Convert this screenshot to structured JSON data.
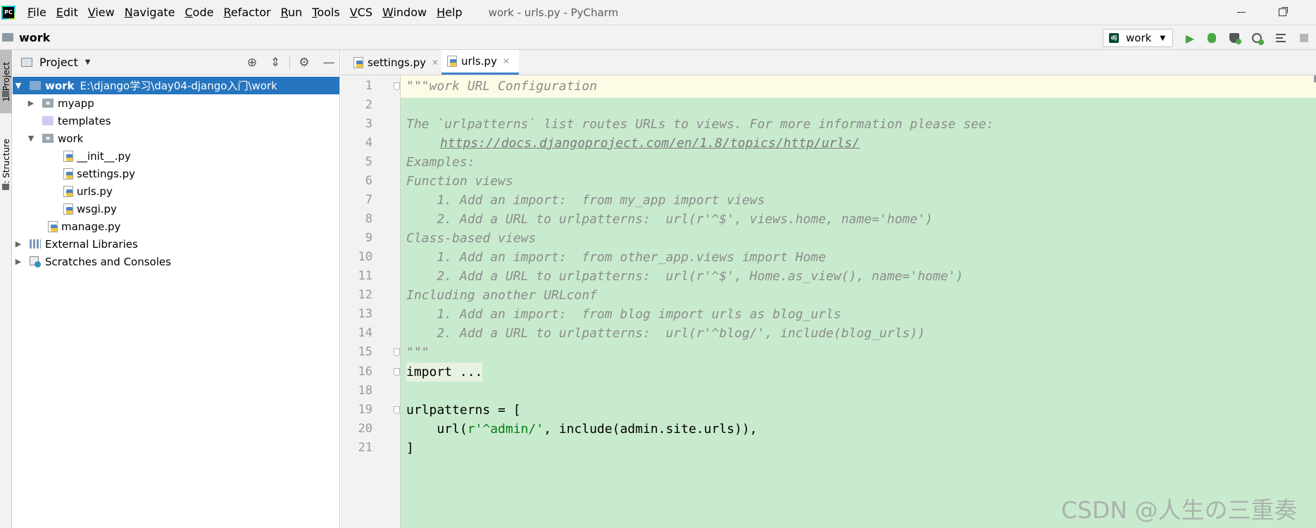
{
  "menubar": {
    "items": [
      "File",
      "Edit",
      "View",
      "Navigate",
      "Code",
      "Refactor",
      "Run",
      "Tools",
      "VCS",
      "Window",
      "Help"
    ],
    "title": "work - urls.py - PyCharm"
  },
  "navbar": {
    "project": "work",
    "run_config": "work"
  },
  "tool_strip": {
    "project_tab": "1: Project",
    "structure_tab": "Z: Structure"
  },
  "project_panel": {
    "title": "Project",
    "tree": [
      {
        "label": "work",
        "path": "E:\\django学习\\day04-django入门\\work"
      },
      {
        "label": "myapp"
      },
      {
        "label": "templates"
      },
      {
        "label": "work"
      },
      {
        "label": "__init__.py"
      },
      {
        "label": "settings.py"
      },
      {
        "label": "urls.py"
      },
      {
        "label": "wsgi.py"
      },
      {
        "label": "manage.py"
      },
      {
        "label": "External Libraries"
      },
      {
        "label": "Scratches and Consoles"
      }
    ]
  },
  "editor": {
    "tabs": [
      {
        "label": "settings.py"
      },
      {
        "label": "urls.py"
      }
    ],
    "lines": [
      {
        "num": "1",
        "text": "\"\"\"work URL Configuration"
      },
      {
        "num": "2",
        "text": ""
      },
      {
        "num": "3",
        "text": "The `urlpatterns` list routes URLs to views. For more information please see:"
      },
      {
        "num": "4",
        "text": "https://docs.djangoproject.com/en/1.8/topics/http/urls/"
      },
      {
        "num": "5",
        "text": "Examples:"
      },
      {
        "num": "6",
        "text": "Function views"
      },
      {
        "num": "7",
        "text": "    1. Add an import:  from my_app import views"
      },
      {
        "num": "8",
        "text": "    2. Add a URL to urlpatterns:  url(r'^$', views.home, name='home')"
      },
      {
        "num": "9",
        "text": "Class-based views"
      },
      {
        "num": "10",
        "text": "    1. Add an import:  from other_app.views import Home"
      },
      {
        "num": "11",
        "text": "    2. Add a URL to urlpatterns:  url(r'^$', Home.as_view(), name='home')"
      },
      {
        "num": "12",
        "text": "Including another URLconf"
      },
      {
        "num": "13",
        "text": "    1. Add an import:  from blog import urls as blog_urls"
      },
      {
        "num": "14",
        "text": "    2. Add a URL to urlpatterns:  url(r'^blog/', include(blog_urls))"
      },
      {
        "num": "15",
        "text": "\"\"\""
      },
      {
        "num": "16",
        "text": "import ..."
      },
      {
        "num": "18",
        "text": ""
      },
      {
        "num": "19",
        "text": "urlpatterns = ["
      },
      {
        "num": "20",
        "text_pre": "    url(",
        "text_str": "r'^admin/'",
        "text_post": ", include(admin.site.urls)),"
      },
      {
        "num": "21",
        "text": "]"
      }
    ]
  },
  "watermark": "CSDN @人生の三重奏"
}
